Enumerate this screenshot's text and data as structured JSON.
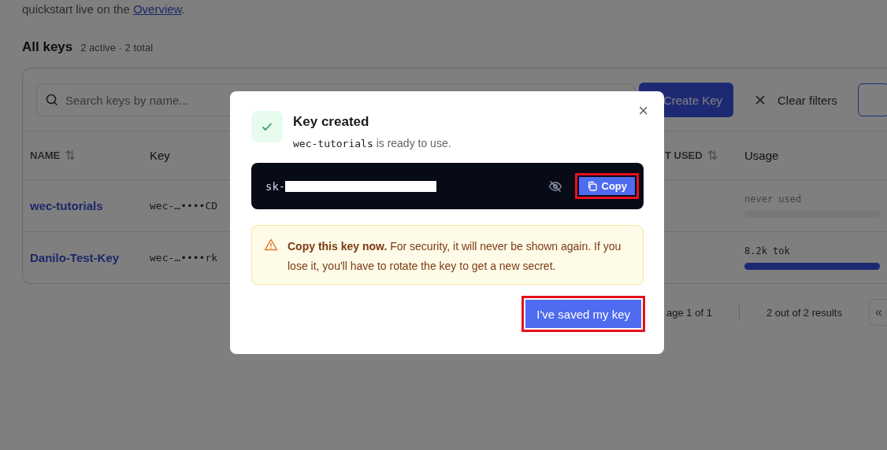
{
  "intro": {
    "text": "quickstart live on the ",
    "link": "Overview",
    "end": "."
  },
  "section": {
    "title": "All keys",
    "meta": "2 active · 2 total"
  },
  "toolbar": {
    "search_placeholder": "Search keys by name...",
    "create_button": "Create Key",
    "clear_button": "Clear filters"
  },
  "table": {
    "columns": [
      {
        "label": "NAME",
        "sort_icon": "⇅"
      },
      {
        "label": "Key"
      },
      {
        "label": "T USED",
        "sort_icon": "⇅"
      },
      {
        "label": "Usage"
      }
    ],
    "rows": [
      {
        "name": "wec-tutorials",
        "key": "wec-…••••CD",
        "usage": "never used"
      },
      {
        "name": "Danilo-Test-Key",
        "key": "wec-…••••rk",
        "usage": "8.2k tok",
        "level": 1
      }
    ]
  },
  "pagination": {
    "page": "age 1 of 1",
    "results": "2 out of 2 results",
    "first_button": "«"
  },
  "dialog": {
    "title": "Key created",
    "key_name": "wec-tutorials",
    "message": "is ready to use.",
    "close": "×",
    "secret_prefix": "sk-",
    "secret_hidden": true,
    "copy_button": "Copy",
    "warning": "**Copy this key now.** For security, it will never be shown again. If you lose it, you'll have to rotate the key to get a new secret.",
    "confirm_button": "I've saved my key",
    "copy_highlighted": true,
    "confirm_highlighted": true
  }
}
